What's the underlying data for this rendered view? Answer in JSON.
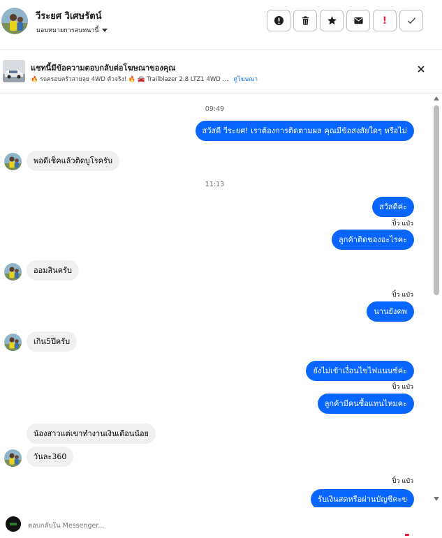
{
  "header": {
    "contact_name": "วีระยศ วิเศษรัตน์",
    "assign_label": "มอบหมายการสนทนานี้",
    "actions": [
      {
        "icon": "alert-circle-icon",
        "label": "!"
      },
      {
        "icon": "trash-icon",
        "label": ""
      },
      {
        "icon": "star-icon",
        "label": ""
      },
      {
        "icon": "mail-icon",
        "label": ""
      },
      {
        "icon": "exclamation-icon",
        "label": "!"
      },
      {
        "icon": "check-icon",
        "label": ""
      }
    ]
  },
  "ad": {
    "title": "แชทนี้มีข้อความตอบกลับต่อโฆษณาของคุณ",
    "subtitle": "🔥 รถครอบครัวสายลุย 4WD ตัวจริง! 🔥 🚘 Trailblazer 2.8 LTZ1 4WD ...",
    "link": "ดูโฆษณา",
    "close_icon": "close-icon"
  },
  "messages": [
    {
      "type": "timestamp",
      "text": "09:49"
    },
    {
      "type": "out",
      "text": "สวัสดี วีระยศ! เราต้องการติดตามผล คุณมีข้อสงสัยใดๆ หรือไม่"
    },
    {
      "type": "in",
      "text": "พอดีเช็คแล้วติดบูโรครับ"
    },
    {
      "type": "timestamp",
      "text": "11:13"
    },
    {
      "type": "out",
      "text": "สวัสดีค่ะ"
    },
    {
      "type": "seen",
      "text": "ปิ๋ว แป๋ว"
    },
    {
      "type": "out",
      "text": "ลูกค้าติดของอะไรคะ"
    },
    {
      "type": "in",
      "text": "ออมสินครับ"
    },
    {
      "type": "seen",
      "text": "ปิ๋ว แป๋ว"
    },
    {
      "type": "out",
      "text": "นานยังคพ"
    },
    {
      "type": "in",
      "text": "เกิน5ปีครับ"
    },
    {
      "type": "out",
      "text": "ยังไม่เข้าเงื่อนไขไฟแนนซ์ค่ะ"
    },
    {
      "type": "seen",
      "text": "ปิ๋ว แป๋ว"
    },
    {
      "type": "out",
      "text": "ลูกค้ามีคนซื้อแทนไหมคะ"
    },
    {
      "type": "in",
      "text": "น้องสาวแต่เขาทำงานเงินเดือนน้อย"
    },
    {
      "type": "in",
      "text": "วันละ360"
    },
    {
      "type": "seen",
      "text": "ปิ๋ว แป๋ว"
    },
    {
      "type": "out",
      "text": "รับเงินสดหรือผ่านบัญชีคะข"
    }
  ],
  "composer": {
    "placeholder": "ตอบกลับใน Messenger..."
  },
  "colors": {
    "outgoing_bubble": "#0866ff",
    "incoming_bubble": "#f0f0f0",
    "link": "#1877f2"
  }
}
